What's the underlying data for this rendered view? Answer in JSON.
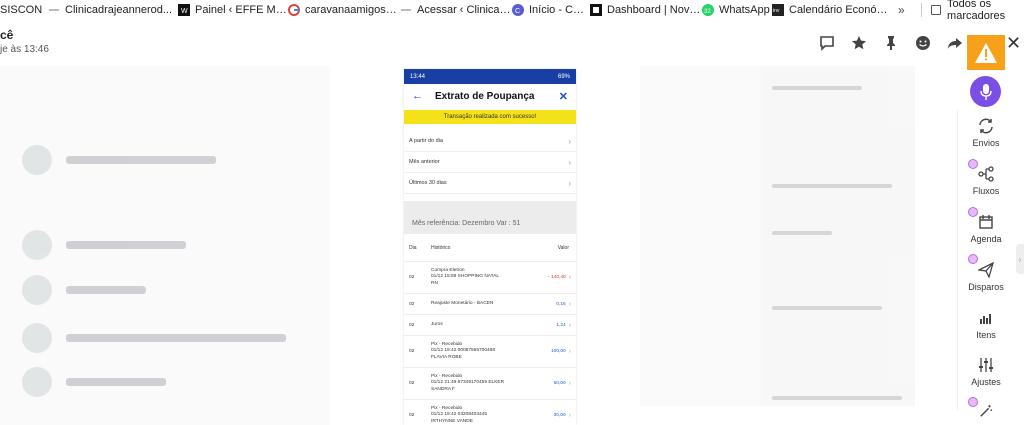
{
  "bookmarks": [
    {
      "label": "SISCON",
      "icon": "none-icon"
    },
    {
      "label": "Clinicadrajeannerod...",
      "icon": "page-icon"
    },
    {
      "label": "Painel ‹ EFFE MULTI...",
      "icon": "wordpress-icon"
    },
    {
      "label": "caravanaamigosem...",
      "icon": "google-icon"
    },
    {
      "label": "Acessar ‹ Clinicadraj...",
      "icon": "page-icon"
    },
    {
      "label": "Início - Canva",
      "icon": "canva-icon"
    },
    {
      "label": "Dashboard | Novo t...",
      "icon": "dashboard-icon"
    },
    {
      "label": "WhatsApp",
      "icon": "whatsapp-icon"
    },
    {
      "label": "Calendário Económi...",
      "icon": "investing-icon"
    }
  ],
  "bookmarks_more": "»",
  "bookmarks_folder": "Todos os marcadores",
  "chat": {
    "name": "cê",
    "subtitle": "je às 13:46"
  },
  "phone": {
    "status_time": "13:44",
    "status_right": "69%",
    "title": "Extrato de Poupança",
    "toast": "Transação realizada com sucesso!",
    "filters": [
      "A partir do dia",
      "Mês anterior",
      "Últimos 30 dias"
    ],
    "month": "Mês referência: Dezembro Var : 51",
    "headers": {
      "day": "Dia",
      "history": "Histórico",
      "value": "Valor"
    },
    "rows": [
      {
        "day": "02",
        "lines": [
          "Compra Eletron",
          "01/12 15:59 SHOPPING NATAL",
          "RN"
        ],
        "value": "- 140,40",
        "kind": "neg"
      },
      {
        "day": "02",
        "lines": [
          "Reajuste Monetário - BACEN"
        ],
        "value": "0,16",
        "kind": "pos"
      },
      {
        "day": "02",
        "lines": [
          "Juros"
        ],
        "value": "1,24",
        "kind": "pos"
      },
      {
        "day": "02",
        "lines": [
          "Pix - Recebido",
          "01/12 19:42 00087555700468",
          "FLAVIA ROBE"
        ],
        "value": "100,00",
        "kind": "pos"
      },
      {
        "day": "02",
        "lines": [
          "Pix - Recebido",
          "01/12 21:49 67349170459 ELKER",
          "SANDRA F"
        ],
        "value": "60,00",
        "kind": "pos"
      },
      {
        "day": "02",
        "lines": [
          "Pix - Recebido",
          "01/12 19:42 03208403445",
          "IRTHYNNE VANDE"
        ],
        "value": "30,00",
        "kind": "pos"
      }
    ]
  },
  "tools": [
    {
      "label": "Envios",
      "icon": "refresh-icon"
    },
    {
      "label": "Fluxos",
      "icon": "flow-icon"
    },
    {
      "label": "Agenda",
      "icon": "calendar-icon"
    },
    {
      "label": "Disparos",
      "icon": "send-icon"
    },
    {
      "label": "Itens",
      "icon": "items-icon"
    },
    {
      "label": "Ajustes",
      "icon": "sliders-icon"
    }
  ],
  "colors": {
    "warning": "#f7a01a",
    "mic": "#7b4fe6",
    "phone_header": "#1a3fa4",
    "toast": "#f5e11a"
  }
}
